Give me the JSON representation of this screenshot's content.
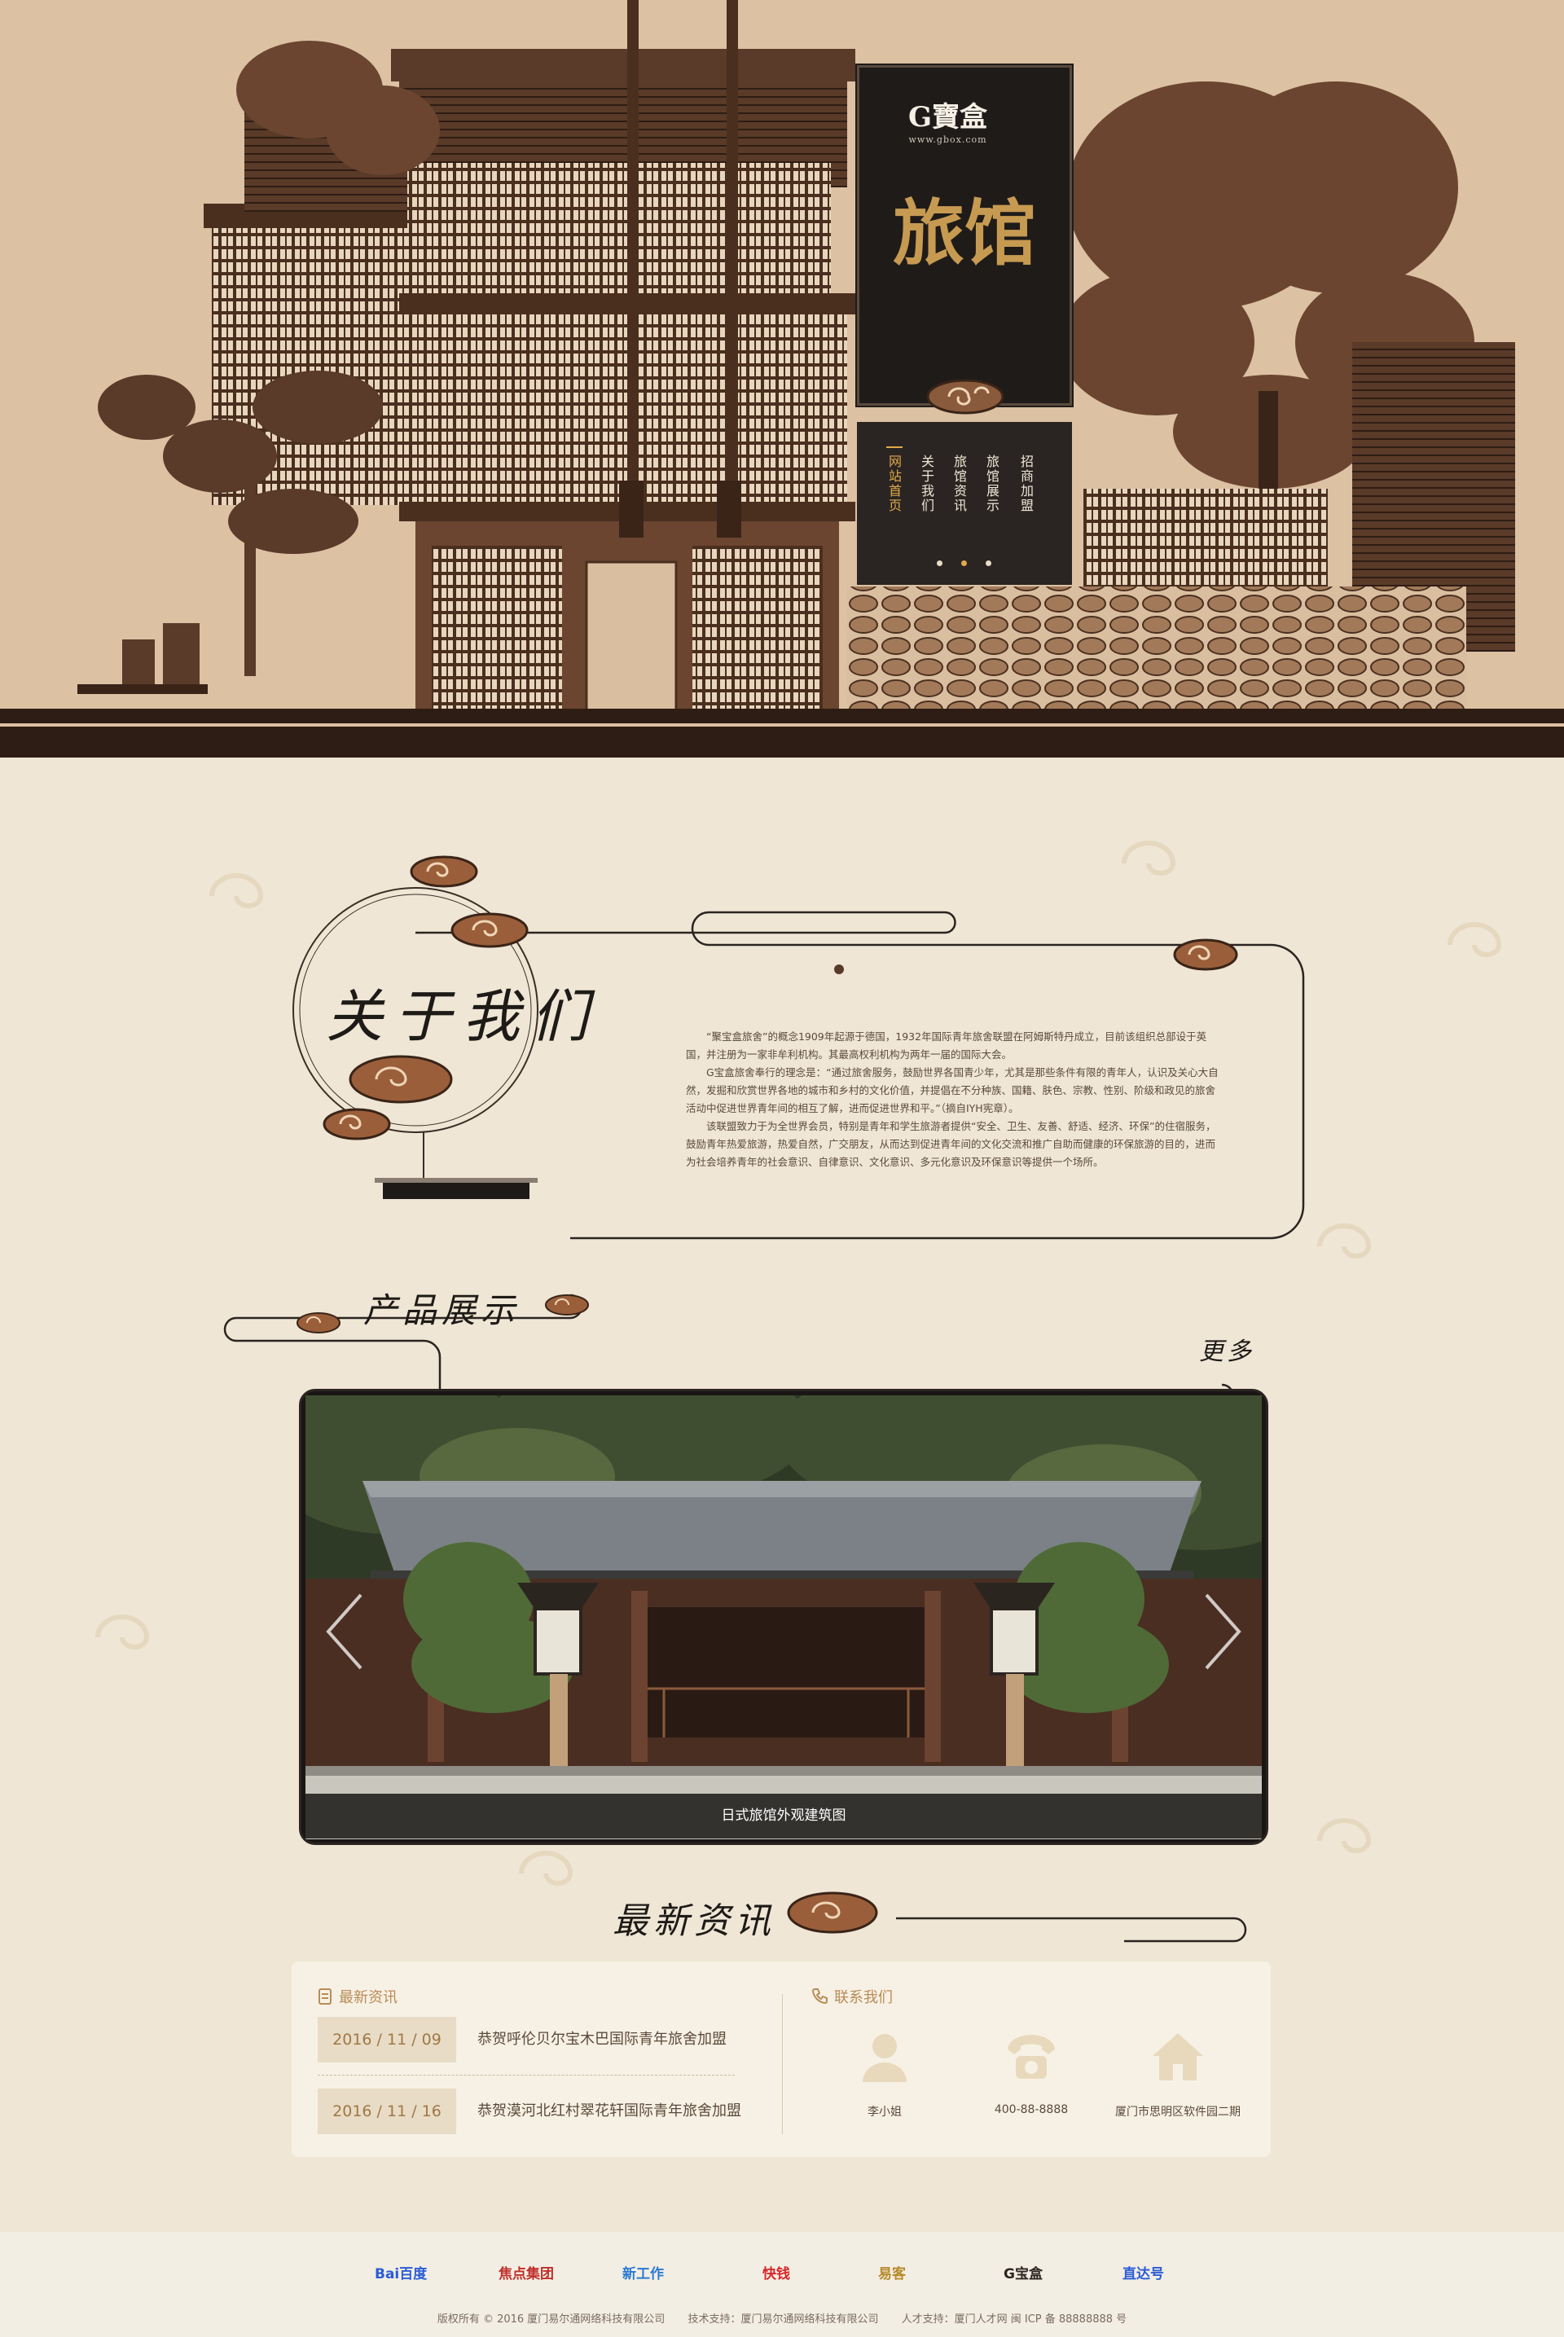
{
  "brand": {
    "logo_text": "G寶盒",
    "logo_url_text": "www.gbox.com",
    "sign_title": "旅馆"
  },
  "nav": [
    {
      "label": "网站首页",
      "active": true
    },
    {
      "label": "关于我们",
      "active": false
    },
    {
      "label": "旅馆资讯",
      "active": false
    },
    {
      "label": "旅馆展示",
      "active": false
    },
    {
      "label": "招商加盟",
      "active": false
    }
  ],
  "about": {
    "title": "关于我们",
    "paragraphs": [
      "“聚宝盒旅舍”的概念1909年起源于德国，1932年国际青年旅舍联盟在阿姆斯特丹成立，目前该组织总部设于英国，并注册为一家非牟利机构。其最高权利机构为两年一届的国际大会。",
      "G宝盒旅舍奉行的理念是：“通过旅舍服务，鼓励世界各国青少年，尤其是那些条件有限的青年人，认识及关心大自然，发掘和欣赏世界各地的城市和乡村的文化价值，并提倡在不分种族、国籍、肤色、宗教、性别、阶级和政见的旅舍活动中促进世界青年间的相互了解，进而促进世界和平。”（摘自IYH宪章）。",
      "该联盟致力于为全世界会员，特别是青年和学生旅游者提供“安全、卫生、友善、舒适、经济、环保”的住宿服务，鼓励青年热爱旅游，热爱自然，广交朋友，从而达到促进青年间的文化交流和推广自助而健康的环保旅游的目的，进而为社会培养青年的社会意识、自律意识、文化意识、多元化意识及环保意识等提供一个场所。"
    ]
  },
  "products": {
    "title": "产品展示",
    "more": "更多",
    "caption": "日式旅馆外观建筑图"
  },
  "news": {
    "heading": "最新资讯",
    "panel_title": "最新资讯",
    "items": [
      {
        "date": "2016 / 11 / 09",
        "title": "恭贺呼伦贝尔宝木巴国际青年旅舍加盟"
      },
      {
        "date": "2016 / 11 / 16",
        "title": "恭贺漠河北红村翠花轩国际青年旅舍加盟"
      }
    ]
  },
  "contact": {
    "title": "联系我们",
    "items": [
      {
        "icon": "person-icon",
        "label": "李小姐"
      },
      {
        "icon": "phone-icon",
        "label": "400-88-8888"
      },
      {
        "icon": "home-icon",
        "label": "厦门市思明区软件园二期"
      }
    ]
  },
  "partners": [
    "Bai百度",
    "焦点集团",
    "新工作",
    "快钱",
    "易客",
    "G宝盒",
    "直达号"
  ],
  "footer": {
    "copyright": "版权所有 © 2016 厦门易尔通网络科技有限公司",
    "tech": "技术支持：厦门易尔通网络科技有限公司",
    "talent": "人才支持：厦门人才网 闽 ICP 备 88888888 号"
  },
  "colors": {
    "accent": "#c79a52",
    "dark": "#1f1b19",
    "cream": "#efe6d5",
    "brown": "#8a5a3c"
  }
}
